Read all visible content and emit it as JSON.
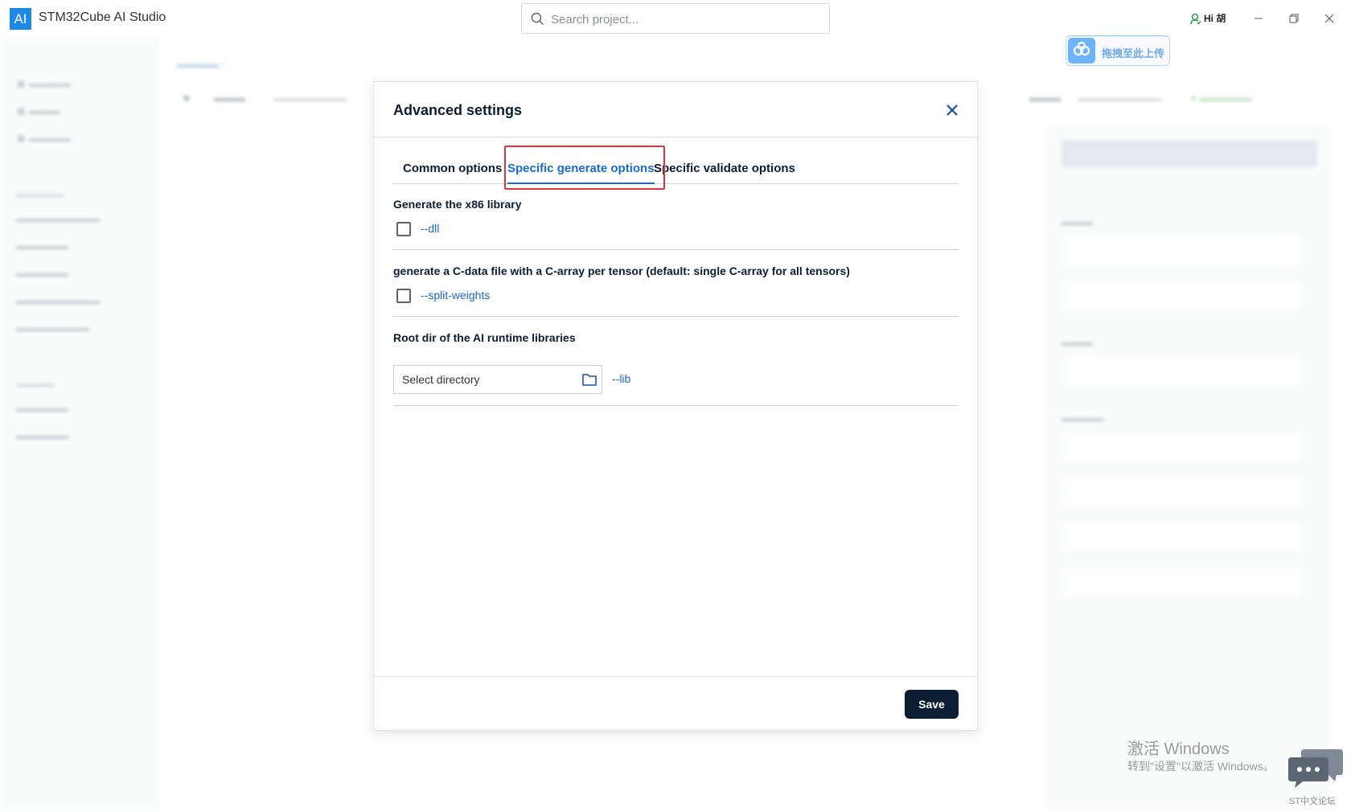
{
  "app": {
    "logo_text": "AI",
    "title": "STM32Cube AI Studio"
  },
  "search": {
    "placeholder": "Search project..."
  },
  "user": {
    "greeting": "Hi 胡"
  },
  "upload_badge": {
    "label": "拖拽至此上传"
  },
  "modal": {
    "title": "Advanced settings",
    "tabs": [
      {
        "label": "Common options",
        "active": false
      },
      {
        "label": "Specific generate options",
        "active": true
      },
      {
        "label": "Specific validate options",
        "active": false
      }
    ],
    "sections": [
      {
        "title": "Generate the x86 library",
        "flag": "--dll",
        "checked": false
      },
      {
        "title": "generate a C-data file with a C-array per tensor (default: single C-array for all tensors)",
        "flag": "--split-weights",
        "checked": false
      },
      {
        "title": "Root dir of the AI runtime libraries",
        "input_value": "Select directory",
        "flag": "--lib"
      }
    ],
    "save_label": "Save"
  },
  "watermark": {
    "line1": "激活 Windows",
    "line2": "转到\"设置\"以激活 Windows。",
    "forum": "ST中文论坛"
  },
  "colors": {
    "accent": "#1a6ad1",
    "primary_dark": "#0b1e33",
    "highlight_border": "#e0353f"
  }
}
